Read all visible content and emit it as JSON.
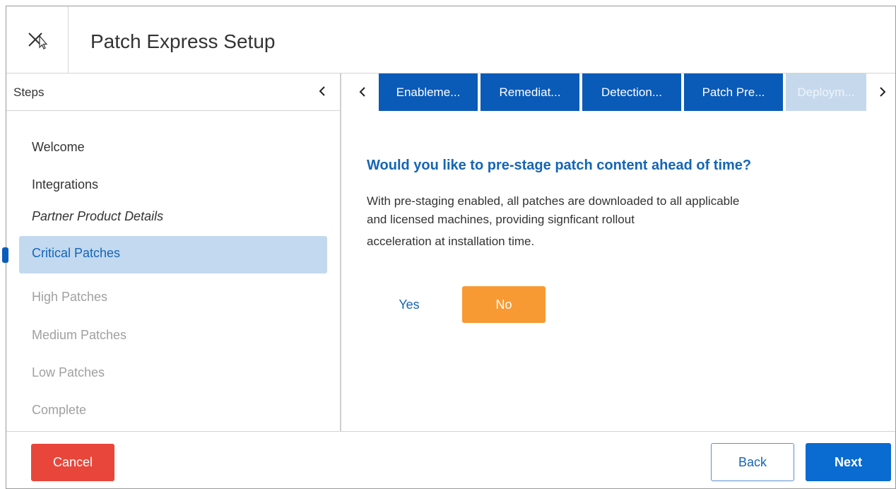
{
  "header": {
    "close_icon": "close-x-icon",
    "title": "Patch Express Setup"
  },
  "sidebar": {
    "heading": "Steps",
    "collapse_icon": "chevron-left-icon",
    "steps": [
      {
        "label": "Welcome",
        "state": "done"
      },
      {
        "label": "Integrations",
        "state": "done"
      },
      {
        "label": "Partner Product Details",
        "state": "done"
      },
      {
        "label": "Critical Patches",
        "state": "active"
      },
      {
        "label": "High Patches",
        "state": "disabled"
      },
      {
        "label": "Medium Patches",
        "state": "disabled"
      },
      {
        "label": "Low Patches",
        "state": "disabled"
      },
      {
        "label": "Complete",
        "state": "disabled"
      }
    ]
  },
  "tabs": {
    "prev_icon": "chevron-left-icon",
    "next_icon": "chevron-right-icon",
    "items": [
      {
        "label": "Enableme..."
      },
      {
        "label": "Remediat..."
      },
      {
        "label": "Detection..."
      },
      {
        "label": "Patch Pre..."
      },
      {
        "label": "Deploym..."
      }
    ]
  },
  "content": {
    "question": "Would you like to pre-stage patch content ahead of time?",
    "description_lines": [
      "With pre-staging enabled, all patches are downloaded to all applicable",
      " and licensed machines, providing signficant rollout",
      "acceleration at installation time."
    ],
    "yes_label": "Yes",
    "no_label": "No"
  },
  "footer": {
    "cancel_label": "Cancel",
    "back_label": "Back",
    "next_label": "Next"
  },
  "colors": {
    "primary_blue": "#0a5ab8",
    "active_step_bg": "#c3d9ef",
    "selected_option": "#f79a33",
    "cancel_red": "#e8463a"
  }
}
